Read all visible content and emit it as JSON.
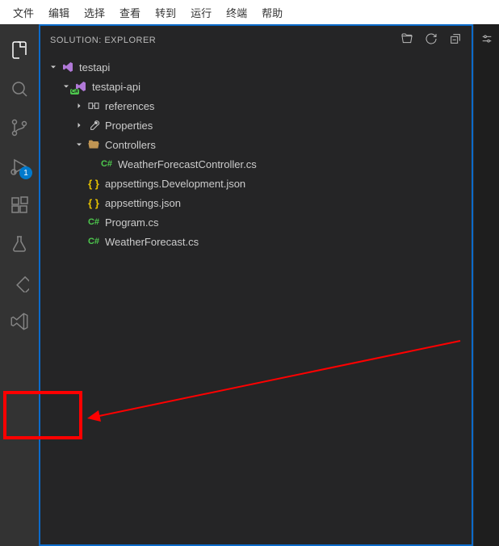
{
  "menubar": {
    "items": [
      "文件",
      "编辑",
      "选择",
      "查看",
      "转到",
      "运行",
      "终端",
      "帮助"
    ]
  },
  "activity_bar": {
    "debug_badge": "1"
  },
  "sidebar": {
    "title": "SOLUTION: EXPLORER"
  },
  "tree": {
    "root": {
      "label": "testapi",
      "children": [
        {
          "label": "testapi-api",
          "children": [
            {
              "label": "references",
              "kind": "ref"
            },
            {
              "label": "Properties",
              "kind": "prop"
            },
            {
              "label": "Controllers",
              "kind": "folder",
              "expanded": true,
              "children": [
                {
                  "label": "WeatherForecastController.cs",
                  "kind": "cs"
                }
              ]
            },
            {
              "label": "appsettings.Development.json",
              "kind": "json"
            },
            {
              "label": "appsettings.json",
              "kind": "json"
            },
            {
              "label": "Program.cs",
              "kind": "cs"
            },
            {
              "label": "WeatherForecast.cs",
              "kind": "cs"
            }
          ]
        }
      ]
    }
  }
}
